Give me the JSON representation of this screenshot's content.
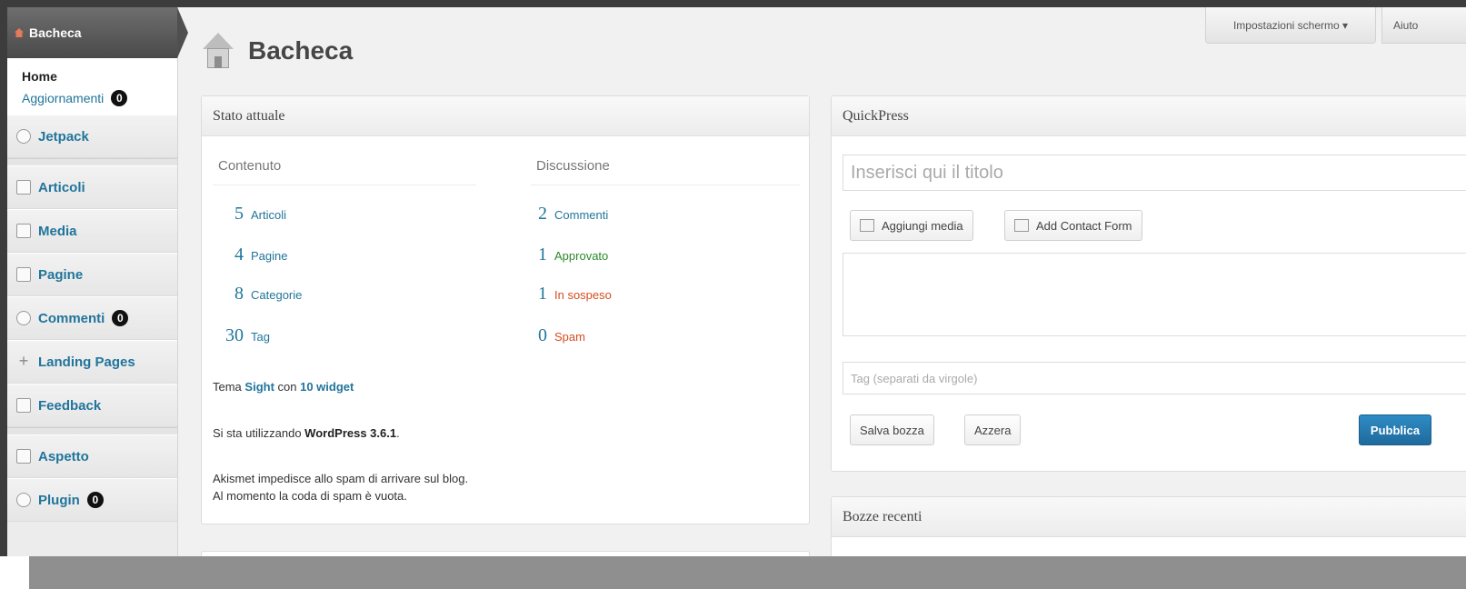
{
  "sidebar": {
    "current": {
      "label": "Bacheca",
      "icon": "house-icon"
    },
    "submenu": [
      {
        "label": "Home",
        "badge": null
      },
      {
        "label": "Aggiornamenti",
        "badge": "0"
      }
    ],
    "items_group1": [
      {
        "label": "Jetpack",
        "icon": "jetpack-icon",
        "badge": null
      }
    ],
    "items_group2": [
      {
        "label": "Articoli",
        "icon": "pin-icon",
        "badge": null
      },
      {
        "label": "Media",
        "icon": "media-icon",
        "badge": null
      },
      {
        "label": "Pagine",
        "icon": "page-icon",
        "badge": null
      },
      {
        "label": "Commenti",
        "icon": "comment-icon",
        "badge": "0"
      },
      {
        "label": "Landing Pages",
        "icon": "plus-icon",
        "badge": null
      },
      {
        "label": "Feedback",
        "icon": "feedback-icon",
        "badge": null
      }
    ],
    "items_group3": [
      {
        "label": "Aspetto",
        "icon": "appearance-icon",
        "badge": null
      },
      {
        "label": "Plugin",
        "icon": "plugin-icon",
        "badge": "0"
      }
    ]
  },
  "header": {
    "screen_options": "Impostazioni schermo ▾",
    "help": "Aiuto",
    "page_title": "Bacheca"
  },
  "stato": {
    "title": "Stato attuale",
    "content_heading": "Contenuto",
    "discussion_heading": "Discussione",
    "content_rows": [
      {
        "num": "5",
        "label": "Articoli"
      },
      {
        "num": "4",
        "label": "Pagine"
      },
      {
        "num": "8",
        "label": "Categorie"
      },
      {
        "num": "30",
        "label": "Tag"
      }
    ],
    "discussion_rows": [
      {
        "num": "2",
        "label": "Commenti",
        "kind": "total"
      },
      {
        "num": "1",
        "label": "Approvato",
        "kind": "approved"
      },
      {
        "num": "1",
        "label": "In sospeso",
        "kind": "pending"
      },
      {
        "num": "0",
        "label": "Spam",
        "kind": "spam"
      }
    ],
    "theme_prefix": "Tema ",
    "theme_name": "Sight",
    "theme_middle": " con ",
    "widget_count": "10 widget",
    "wp_prefix": "Si sta utilizzando ",
    "wp_version": "WordPress 3.6.1",
    "wp_suffix": ".",
    "akismet_line1": "Akismet impedisce allo spam di arrivare sul blog.",
    "akismet_line2": "Al momento la coda di spam è vuota."
  },
  "quickpress": {
    "title": "QuickPress",
    "title_placeholder": "Inserisci qui il titolo",
    "add_media": "Aggiungi media",
    "add_contact_form": "Add Contact Form",
    "tags_placeholder": "Tag (separati da virgole)",
    "save_draft": "Salva bozza",
    "reset": "Azzera",
    "publish": "Pubblica"
  },
  "bozze": {
    "title": "Bozze recenti"
  }
}
